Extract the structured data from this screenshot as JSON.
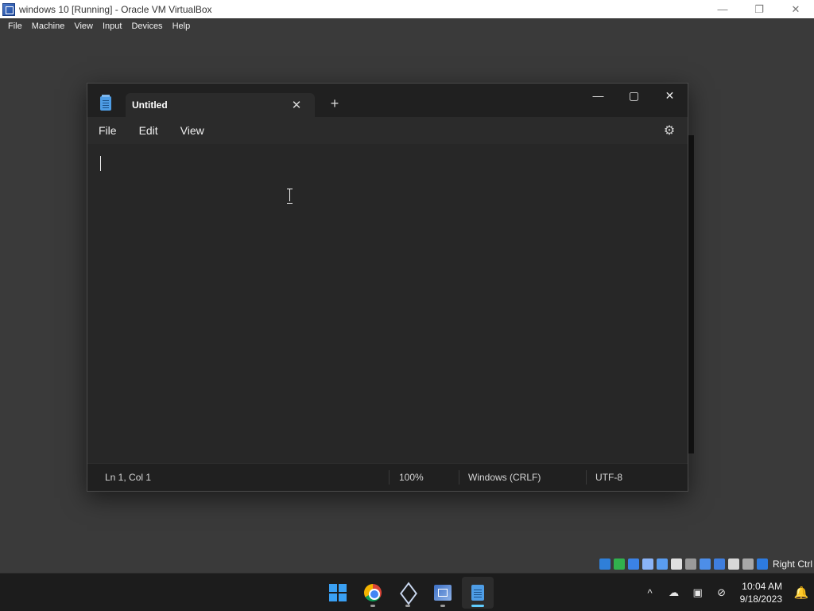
{
  "virtualbox": {
    "title": "windows 10 [Running] - Oracle VM VirtualBox",
    "menu": [
      "File",
      "Machine",
      "View",
      "Input",
      "Devices",
      "Help"
    ],
    "controls": {
      "minimize": "—",
      "restore": "❐",
      "close": "✕"
    },
    "host_key": "Right Ctrl",
    "indicators": [
      {
        "name": "hard-disk-icon",
        "color": "#2f7fd8"
      },
      {
        "name": "optical-drive-icon",
        "color": "#31b24d"
      },
      {
        "name": "floppy-icon",
        "color": "#3b82e6"
      },
      {
        "name": "audio-icon",
        "color": "#8ab4f8"
      },
      {
        "name": "network-icon",
        "color": "#5a9df0"
      },
      {
        "name": "usb-icon",
        "color": "#e0e0e0"
      },
      {
        "name": "shared-folders-icon",
        "color": "#9a9a9a"
      },
      {
        "name": "display-icon",
        "color": "#4d8ee8"
      },
      {
        "name": "recording-icon",
        "color": "#3f7ede"
      },
      {
        "name": "cpu-icon",
        "color": "#d7d7d7"
      },
      {
        "name": "mouse-integration-icon",
        "color": "#a8a8a8"
      },
      {
        "name": "keyboard-icon",
        "color": "#2d7be0"
      }
    ]
  },
  "notepad": {
    "tab_title": "Untitled",
    "tab_close": "✕",
    "new_tab": "+",
    "window_controls": {
      "minimize": "—",
      "maximize": "▢",
      "close": "✕"
    },
    "menu": [
      "File",
      "Edit",
      "View"
    ],
    "settings_icon": "⚙",
    "content": "",
    "status": {
      "position": "Ln 1, Col 1",
      "zoom": "100%",
      "line_ending": "Windows (CRLF)",
      "encoding": "UTF-8"
    }
  },
  "taskbar": {
    "apps": [
      {
        "name": "start-button",
        "icon": "windows-logo-icon",
        "active": false
      },
      {
        "name": "chrome-button",
        "icon": "chrome-icon",
        "active": false
      },
      {
        "name": "virtualbox-button",
        "icon": "virtualbox-icon",
        "active": false
      },
      {
        "name": "vbox-tool-button",
        "icon": "vbox-tool-icon",
        "active": false
      },
      {
        "name": "notepad-button",
        "icon": "notepad-icon",
        "active": true
      }
    ],
    "tray": {
      "overflow_icon": "^",
      "onedrive_icon": "☁",
      "network_icon": "▣",
      "volume_icon": "⊘",
      "time": "10:04 AM",
      "date": "9/18/2023",
      "notification_icon": "🔔"
    }
  }
}
